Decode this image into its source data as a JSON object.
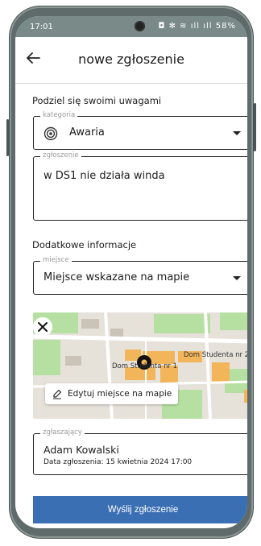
{
  "status_bar": {
    "time": "17:01",
    "icons_text": "◘ ✻ ≋ ıll ıll",
    "battery": "58%"
  },
  "header": {
    "title": "nowe zgłoszenie"
  },
  "feedback_section": {
    "title": "Podziel się swoimi uwagami"
  },
  "category": {
    "label": "kategoria",
    "value": "Awaria"
  },
  "report": {
    "label": "zgłoszenie",
    "value": "w DS1 nie działa winda"
  },
  "extra_section": {
    "title": "Dodatkowe informacje"
  },
  "place": {
    "label": "miejsce",
    "value": "Miejsce wskazane na mapie"
  },
  "map": {
    "label_1": "Dom Studenta nr 2",
    "label_2": "Dom Studenta nr 1",
    "edit_label": "Edytuj miejsce na mapie"
  },
  "reporter": {
    "label": "zgłaszający",
    "name": "Adam Kowalski",
    "date": "Data zgłoszenia: 15 kwietnia 2024 17:00"
  },
  "submit": {
    "label": "Wyślij zgłoszenie"
  },
  "colors": {
    "accent": "#3b6fb4",
    "status_bar": "#7a8a89",
    "building": "#f2b55a",
    "park": "#b6e0a2"
  }
}
